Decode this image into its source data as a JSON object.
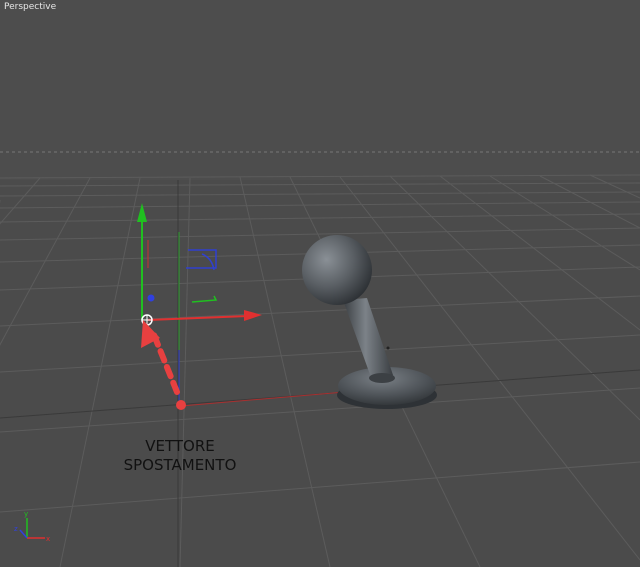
{
  "viewport": {
    "title": "Perspective"
  },
  "annotation": {
    "line1": "VETTORE",
    "line2": "SPOSTAMENTO"
  },
  "colors": {
    "background": "#4b4b4b",
    "grid": "#5c5c5c",
    "axis_x": "#e03030",
    "axis_y": "#20c020",
    "axis_z": "#3040e0",
    "displacement_arrow": "#e84040",
    "object_gray": "#5e6368"
  },
  "objects": [
    {
      "name": "joystick",
      "parts": [
        "sphere-knob",
        "cylinder-stick",
        "disc-base"
      ]
    },
    {
      "name": "move-gizmo",
      "axes": [
        "x",
        "y",
        "z"
      ]
    }
  ],
  "orientation_gizmo": {
    "axes": [
      "x",
      "y",
      "z"
    ]
  }
}
